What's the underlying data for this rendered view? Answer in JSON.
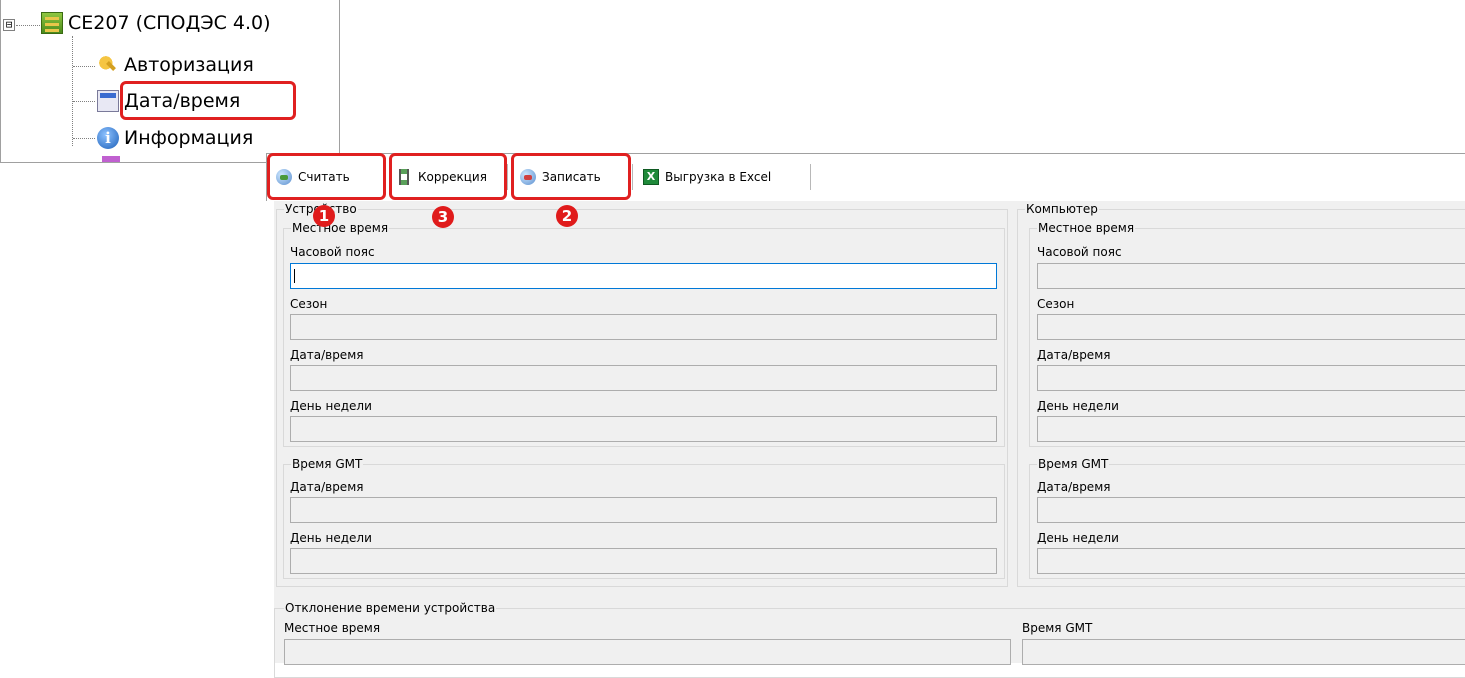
{
  "tree": {
    "root": "СЕ207 (СПОДЭС 4.0)",
    "expander": "⊟",
    "items": [
      {
        "label": "Авторизация",
        "icon": "key-icon"
      },
      {
        "label": "Дата/время",
        "icon": "calendar-clock-icon"
      },
      {
        "label": "Информация",
        "icon": "info-icon"
      }
    ]
  },
  "toolbar": {
    "read": "Считать",
    "correct": "Коррекция",
    "write": "Записать",
    "excel": "Выгрузка в Excel",
    "excel_icon_letter": "X"
  },
  "device": {
    "title": "Устройство",
    "local": {
      "title": "Местное время",
      "timezone_label": "Часовой пояс",
      "timezone_value": "",
      "season_label": "Сезон",
      "season_value": "",
      "datetime_label": "Дата/время",
      "datetime_value": "",
      "weekday_label": "День недели",
      "weekday_value": ""
    },
    "gmt": {
      "title": "Время GMT",
      "datetime_label": "Дата/время",
      "datetime_value": "",
      "weekday_label": "День недели",
      "weekday_value": ""
    }
  },
  "computer": {
    "title": "Компьютер",
    "local": {
      "title": "Местное время",
      "timezone_label": "Часовой пояс",
      "timezone_value": "",
      "season_label": "Сезон",
      "season_value": "",
      "datetime_label": "Дата/время",
      "datetime_value": "",
      "weekday_label": "День недели",
      "weekday_value": ""
    },
    "gmt": {
      "title": "Время GMT",
      "datetime_label": "Дата/время",
      "datetime_value": "",
      "weekday_label": "День недели",
      "weekday_value": ""
    }
  },
  "deviation": {
    "title": "Отклонение времени устройства",
    "local_label": "Местное время",
    "gmt_label": "Время GMT"
  },
  "markers": {
    "read": "1",
    "write": "2",
    "correct": "3"
  },
  "colors": {
    "highlight": "#e02020",
    "marker": "#e01b1b",
    "focus": "#0078d7",
    "panel": "#f0f0f0"
  }
}
